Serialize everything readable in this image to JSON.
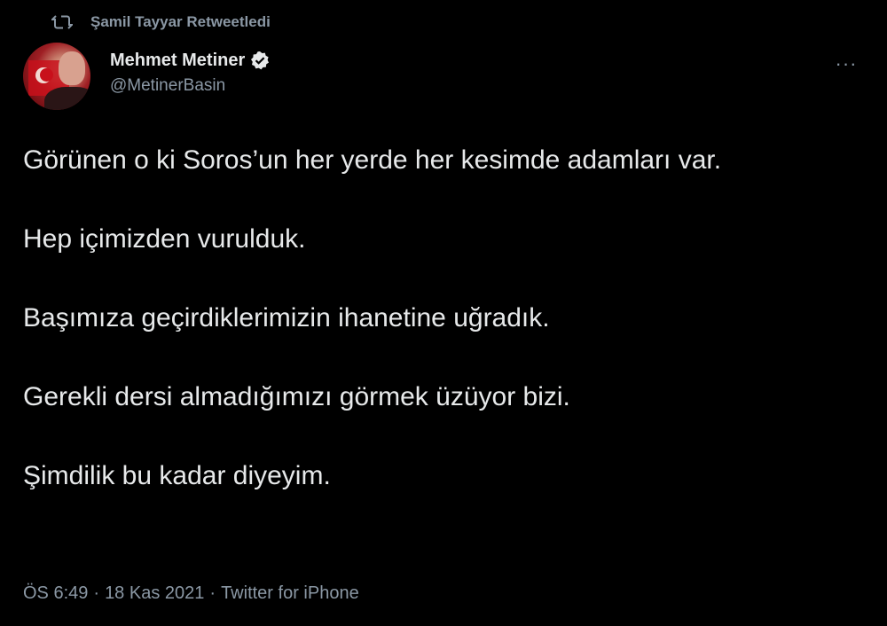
{
  "retweet": {
    "text": "Şamil Tayyar Retweetledi",
    "icon": "retweet-icon"
  },
  "author": {
    "display_name": "Mehmet Metiner",
    "handle": "@MetinerBasin",
    "verified": true,
    "avatar_icon": "avatar"
  },
  "more_label": "···",
  "tweet": {
    "paragraphs": [
      "Görünen o ki Soros’un her yerde her kesimde adamları var.",
      "Hep içimizden vurulduk.",
      "Başımıza geçirdiklerimizin ihanetine uğradık.",
      "Gerekli dersi almadığımızı görmek üzüyor bizi.",
      "Şimdilik bu kadar diyeyim."
    ]
  },
  "meta": {
    "time": "ÖS 6:49",
    "date": "18 Kas 2021",
    "source": "Twitter for iPhone",
    "separator": "·"
  },
  "colors": {
    "background": "#000000",
    "text": "#e7e9ea",
    "secondary": "#8b98a5",
    "verified": "#e7e9ea"
  }
}
